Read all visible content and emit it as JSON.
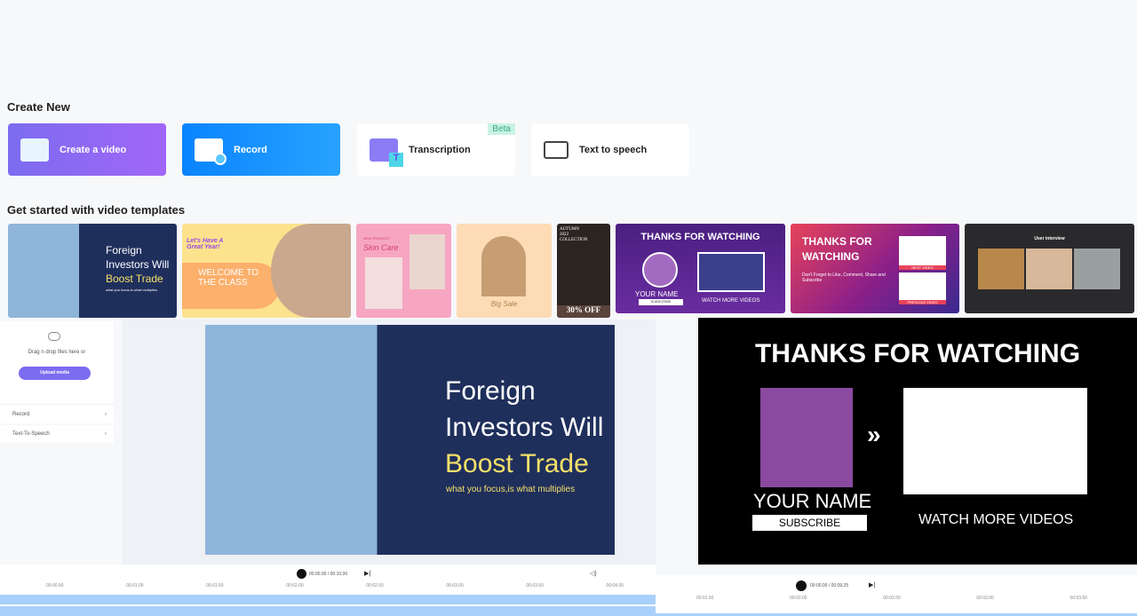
{
  "create_new": {
    "title": "Create New",
    "cards": [
      {
        "label": "Create a video",
        "icon": "video-sparkle-icon",
        "color": "#8b5cf6"
      },
      {
        "label": "Record",
        "icon": "record-icon",
        "color": "#1e90ff"
      },
      {
        "label": "Transcription",
        "icon": "transcription-icon",
        "badge": "Beta"
      },
      {
        "label": "Text to speech",
        "icon": "text-to-speech-icon"
      }
    ]
  },
  "templates": {
    "title": "Get started with video templates",
    "items": [
      {
        "lines": [
          "Foreign",
          "Investors Will",
          "Boost Trade"
        ],
        "sub": "what you focus,is what multiplies"
      },
      {
        "lines": [
          "Let's Have A",
          "Great Year!",
          "WELCOME TO",
          "THE CLASS"
        ]
      },
      {
        "lines": [
          "NEW PRODUCT",
          "Skin Care"
        ]
      },
      {
        "lines": [
          "Big Sale"
        ]
      },
      {
        "lines": [
          "AUTUMN",
          "2022",
          "COLLECTION",
          "30% OFF"
        ]
      },
      {
        "lines": [
          "THANKS FOR WATCHING",
          "YOUR NAME",
          "SUBSCRIBE",
          "WATCH MORE VIDEOS"
        ]
      },
      {
        "lines": [
          "THANKS FOR",
          "WATCHING",
          "Don't Forget to Like, Comment, Share and Subscribe",
          "NEXT VIDEO",
          "PREVIOUS VIDEO"
        ]
      },
      {
        "lines": [
          "User interview"
        ]
      }
    ]
  },
  "upload": {
    "hint": "Drag n drop files here or",
    "button": "Upload media",
    "items": [
      "Record",
      "Text-To-Speech"
    ]
  },
  "preview_left": {
    "lines": [
      "Foreign",
      "Investors Will",
      "Boost Trade"
    ],
    "sub": "what you focus,is what multiplies"
  },
  "preview_right": {
    "title": "THANKS FOR WATCHING",
    "name": "YOUR NAME",
    "subscribe": "SUBSCRIBE",
    "watch": "WATCH MORE VIDEOS"
  },
  "timeline_left": {
    "current": "00:00.00",
    "total": "/ 00:10.00",
    "ticks": [
      "00:00.50",
      "00:01.00",
      "00:01.50",
      "00:02.00",
      "00:02.50",
      "00:03.00",
      "00:03.50",
      "00:04.00"
    ]
  },
  "timeline_right": {
    "current": "00:00.00",
    "total": "/ 00:09.25",
    "ticks": [
      "00:01.50",
      "00:02.00",
      "00:02.50",
      "00:03.00",
      "00:03.50"
    ]
  }
}
